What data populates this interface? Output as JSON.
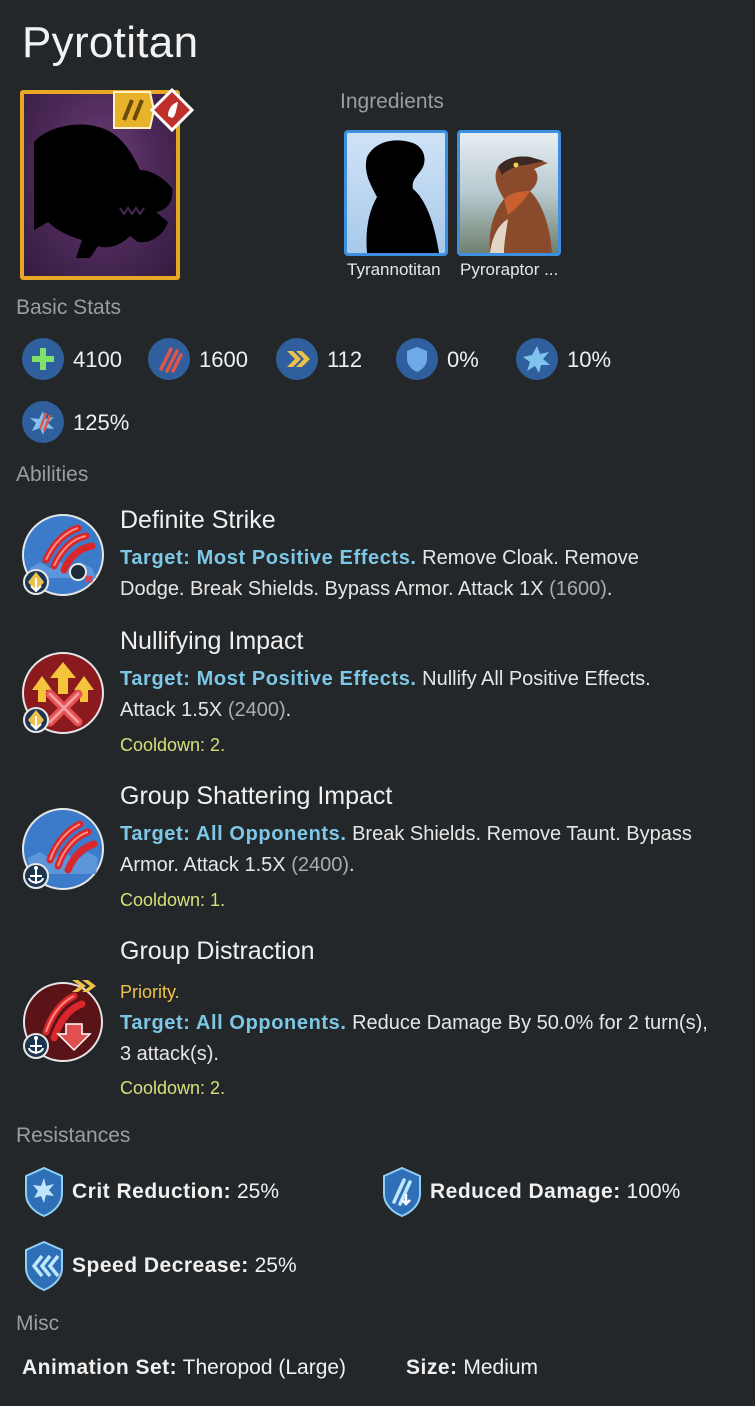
{
  "title": "Pyrotitan",
  "sections": {
    "ingredients": "Ingredients",
    "basic_stats": "Basic Stats",
    "abilities": "Abilities",
    "resistances": "Resistances",
    "misc": "Misc"
  },
  "ingredients": [
    {
      "name": "Tyrannotitan"
    },
    {
      "name": "Pyroraptor ..."
    }
  ],
  "stats": [
    {
      "icon": "health-icon",
      "value": "4100"
    },
    {
      "icon": "damage-icon",
      "value": "1600"
    },
    {
      "icon": "speed-icon",
      "value": "112"
    },
    {
      "icon": "armor-icon",
      "value": "0%"
    },
    {
      "icon": "crit-chance-icon",
      "value": "10%"
    },
    {
      "icon": "crit-multiplier-icon",
      "value": "125%"
    }
  ],
  "abilities": [
    {
      "name": "Definite Strike",
      "priority": "",
      "target": "Target: Most Positive Effects.",
      "line1_rest": " Remove Cloak. Remove",
      "line2": "Dodge. Break Shields. Bypass Armor. Attack 1X ",
      "mult": "(1600)",
      "tail": ".",
      "cooldown": ""
    },
    {
      "name": "Nullifying Impact",
      "priority": "",
      "target": "Target: Most Positive Effects.",
      "line1_rest": " Nullify All Positive Effects.",
      "line2": "Attack 1.5X ",
      "mult": "(2400)",
      "tail": ".",
      "cooldown": "Cooldown: 2."
    },
    {
      "name": "Group Shattering Impact",
      "priority": "",
      "target": "Target: All Opponents.",
      "line1_rest": " Break Shields. Remove Taunt. Bypass",
      "line2": "Armor. Attack 1.5X ",
      "mult": "(2400)",
      "tail": ".",
      "cooldown": "Cooldown: 1."
    },
    {
      "name": "Group Distraction",
      "priority": "Priority.",
      "target": "Target: All Opponents.",
      "line1_rest": " Reduce Damage By 50.0% for 2 turn(s),",
      "line2": "3 attack(s).",
      "mult": "",
      "tail": "",
      "cooldown": "Cooldown: 2."
    }
  ],
  "resistances": [
    {
      "label": "Crit Reduction:",
      "value": " 25%"
    },
    {
      "label": "Reduced Damage:",
      "value": " 100%"
    },
    {
      "label": "Speed Decrease:",
      "value": " 25%"
    }
  ],
  "misc": {
    "animation_label": "Animation Set:",
    "animation_value": " Theropod (Large)",
    "size_label": "Size:",
    "size_value": " Medium"
  },
  "colors": {
    "background": "#24272a",
    "portrait_border": "#e8a826",
    "ingredient_border": "#3d8fe0",
    "target_text": "#7cc8e6",
    "cooldown_text": "#d5e07a",
    "priority_text": "#f0c14a",
    "section_label": "#9a9ea3"
  }
}
